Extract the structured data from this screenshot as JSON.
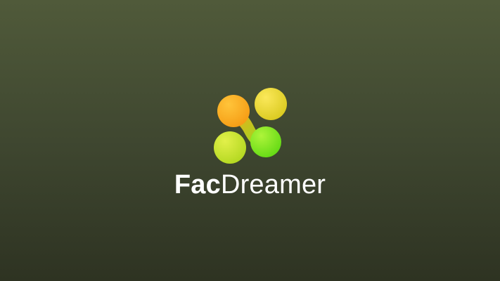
{
  "app": {
    "name_bold": "Fac",
    "name_regular": "Dreamer"
  },
  "logo": {
    "icon": "molecule-blobs-icon",
    "colors": {
      "orange": "#ffa21e",
      "yellow": "#f6dc2a",
      "lime": "#c6ec2c",
      "green": "#7ee81e"
    }
  },
  "theme": {
    "background_top": "#505a3a",
    "background_bottom": "#2e3322",
    "text": "#ffffff"
  }
}
